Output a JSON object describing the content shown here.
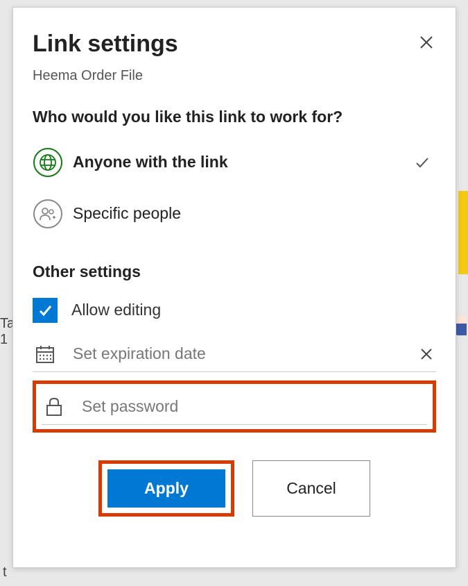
{
  "header": {
    "title": "Link settings",
    "subtitle": "Heema Order File"
  },
  "prompt": "Who would you like this link to work for?",
  "options": {
    "anyone": "Anyone with the link",
    "specific": "Specific people"
  },
  "other_settings": {
    "title": "Other settings",
    "allow_editing": "Allow editing",
    "expiration_placeholder": "Set expiration date",
    "password_placeholder": "Set password"
  },
  "buttons": {
    "apply": "Apply",
    "cancel": "Cancel"
  },
  "colors": {
    "primary": "#0078d4",
    "highlight": "#d83b01",
    "green": "#107c10"
  }
}
